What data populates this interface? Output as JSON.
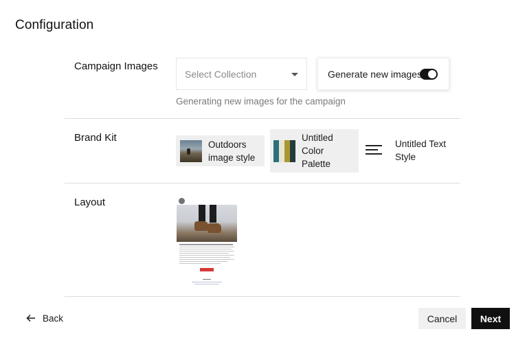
{
  "page": {
    "title": "Configuration"
  },
  "campaign_images": {
    "label": "Campaign Images",
    "select": {
      "placeholder": "Select Collection"
    },
    "generate": {
      "label": "Generate new images",
      "enabled": true
    },
    "helper": "Generating new images for the campaign"
  },
  "brand_kit": {
    "label": "Brand Kit",
    "items": [
      {
        "label": "Outdoors image style",
        "icon": "image-thumbnail"
      },
      {
        "label": "Untitled Color Palette",
        "icon": "palette-swatches",
        "colors": [
          "#2e6f79",
          "#e8e4d2",
          "#a79832",
          "#263b3b"
        ]
      },
      {
        "label": "Untitled Text Style",
        "icon": "text-lines-icon"
      }
    ]
  },
  "layout": {
    "label": "Layout"
  },
  "footer": {
    "back": "Back",
    "cancel": "Cancel",
    "next": "Next"
  }
}
